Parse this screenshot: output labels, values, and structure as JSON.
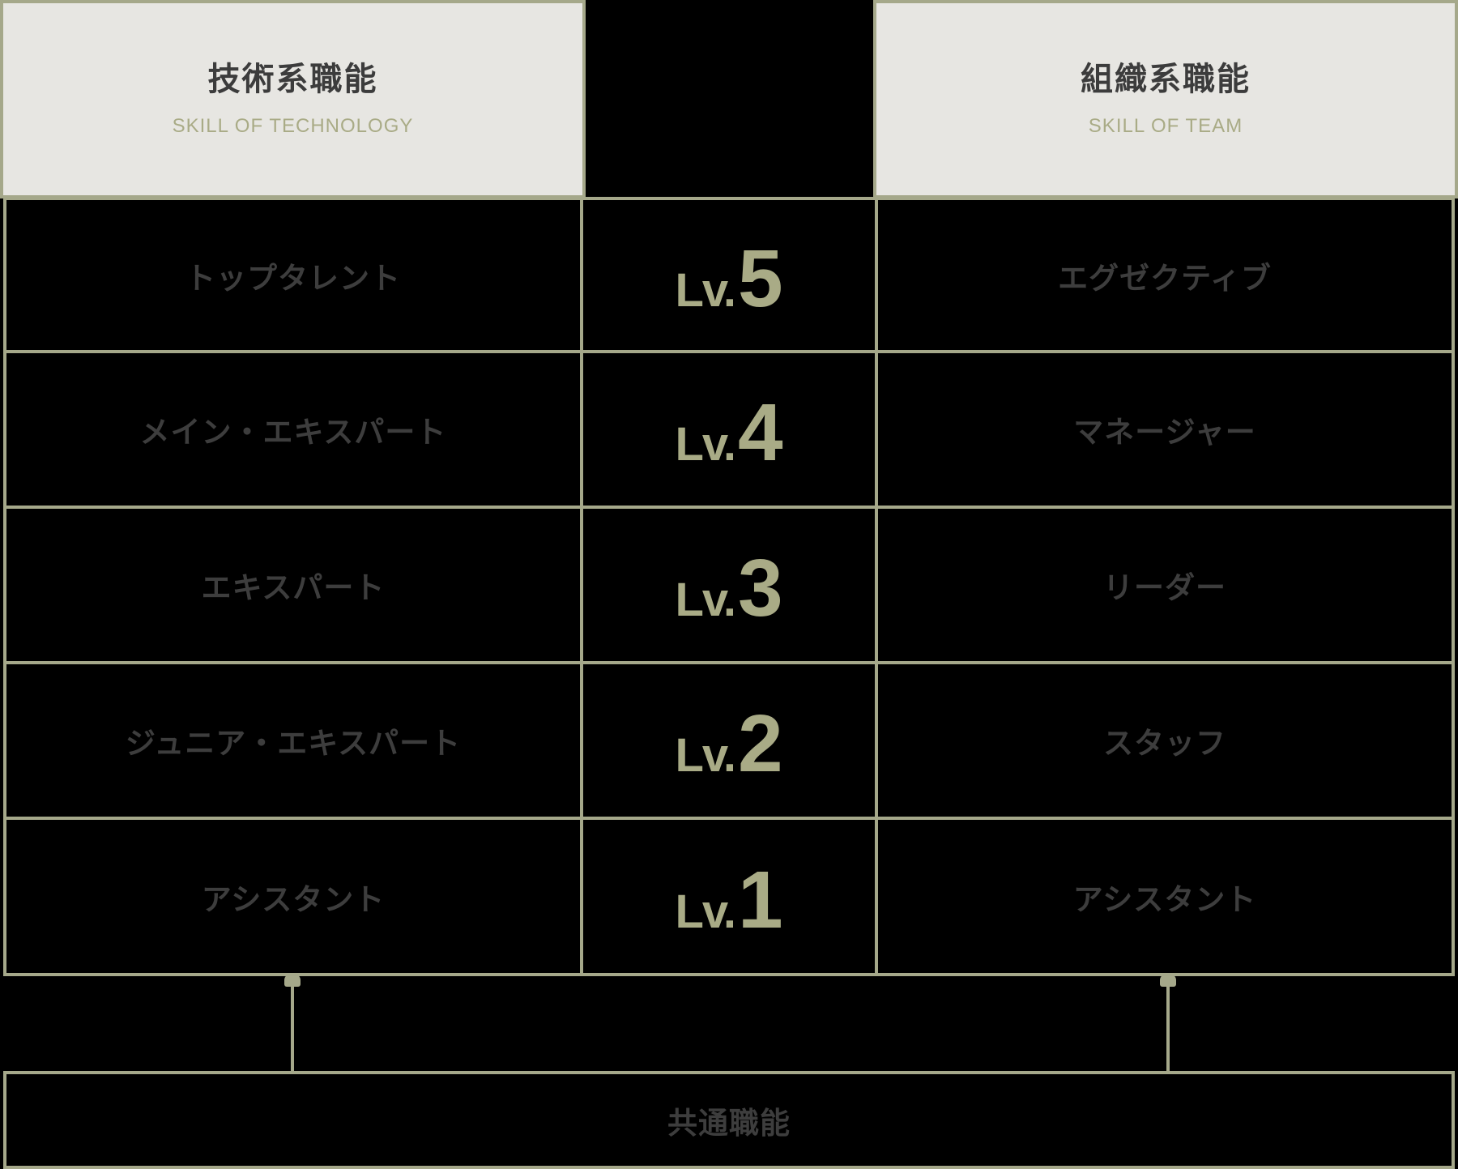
{
  "header": {
    "left": {
      "title": "技術系職能",
      "subtitle": "SKILL OF TECHNOLOGY"
    },
    "right": {
      "title": "組織系職能",
      "subtitle": "SKILL OF TEAM"
    }
  },
  "rows": [
    {
      "technology": "トップタレント",
      "level_prefix": "Lv.",
      "level": "5",
      "team": "エグゼクティブ"
    },
    {
      "technology": "メイン・エキスパート",
      "level_prefix": "Lv.",
      "level": "4",
      "team": "マネージャー"
    },
    {
      "technology": "エキスパート",
      "level_prefix": "Lv.",
      "level": "3",
      "team": "リーダー"
    },
    {
      "technology": "ジュニア・エキスパート",
      "level_prefix": "Lv.",
      "level": "2",
      "team": "スタッフ"
    },
    {
      "technology": "アシスタント",
      "level_prefix": "Lv.",
      "level": "1",
      "team": "アシスタント"
    }
  ],
  "base": {
    "label": "共通職能"
  },
  "colors": {
    "border": "#a5a88a",
    "header_background": "#e7e6e2",
    "accent": "#a9ab86",
    "cell_background": "#000000",
    "text": "#3d3d3d"
  }
}
